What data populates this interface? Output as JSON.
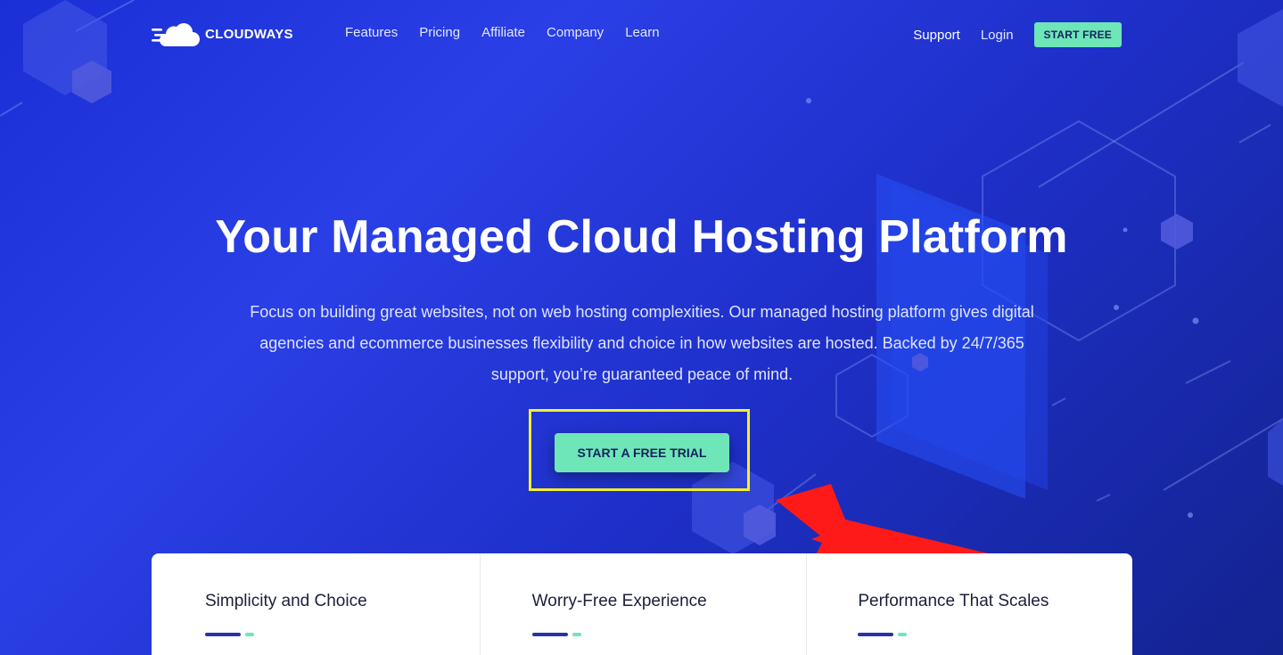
{
  "brand": {
    "name": "CLOUDWAYS"
  },
  "nav": {
    "items": [
      {
        "label": "Features"
      },
      {
        "label": "Pricing"
      },
      {
        "label": "Affiliate"
      },
      {
        "label": "Company"
      },
      {
        "label": "Learn"
      }
    ],
    "support_label": "Support",
    "login_label": "Login",
    "start_free_label": "START FREE"
  },
  "hero": {
    "title": "Your Managed Cloud Hosting Platform",
    "subtitle": "Focus on building great websites, not on web hosting complexities. Our managed hosting platform gives digital agencies and ecommerce businesses flexibility and choice in how websites are hosted. Backed by 24/7/365 support, you’re guaranteed peace of mind.",
    "cta_label": "START A FREE TRIAL"
  },
  "features": [
    {
      "title": "Simplicity and Choice"
    },
    {
      "title": "Worry-Free Experience"
    },
    {
      "title": "Performance That Scales"
    }
  ],
  "colors": {
    "background": "#1e2fc8",
    "accent_green": "#6ee6b8",
    "highlight_yellow": "#f5f02b",
    "annotation_red": "#ff1a1a",
    "navy": "#2b31a8"
  },
  "icons": {
    "logo": "cloud-logo-icon",
    "annotation": "red-arrow-icon"
  }
}
